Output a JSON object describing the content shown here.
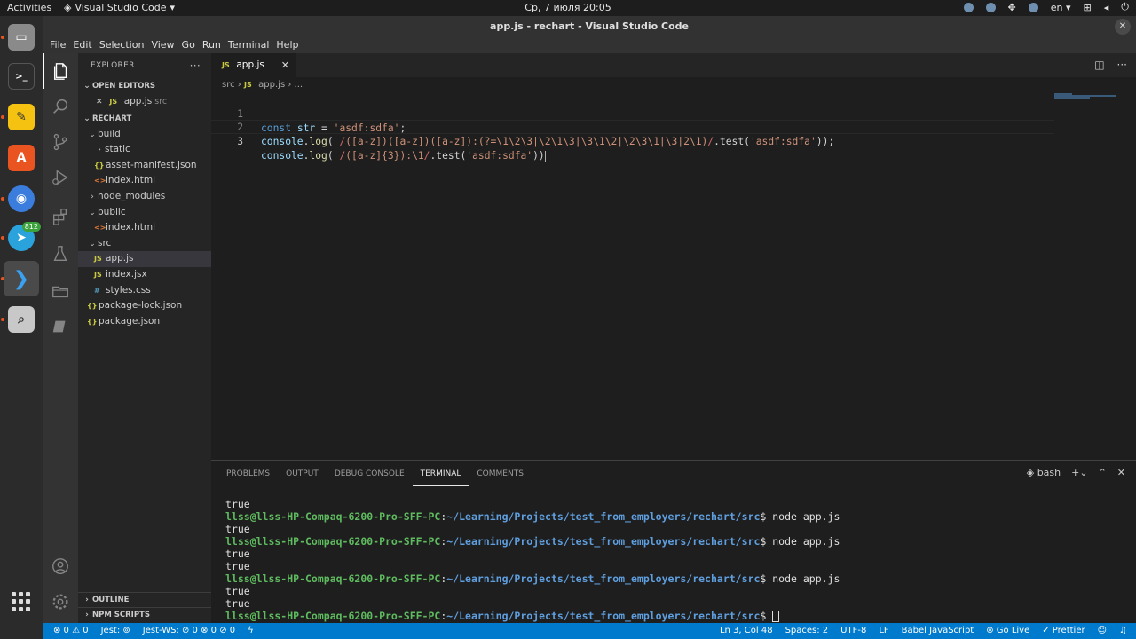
{
  "topbar": {
    "activities": "Activities",
    "app_name": "Visual Studio Code",
    "app_arrow": "▾",
    "clock": "Ср, 7 июля  20:05",
    "lang": "en",
    "lang_arrow": "▾"
  },
  "dock": {
    "telegram_badge": "812"
  },
  "window": {
    "title": "app.js - rechart - Visual Studio Code",
    "close": "✕"
  },
  "menu": [
    "File",
    "Edit",
    "Selection",
    "View",
    "Go",
    "Run",
    "Terminal",
    "Help"
  ],
  "explorer": {
    "title": "EXPLORER",
    "more": "···",
    "open_editors": "OPEN EDITORS",
    "open_file": "app.js",
    "open_file_dir": "src",
    "project": "RECHART",
    "tree": {
      "build": "build",
      "static": "static",
      "asset_manifest": "asset-manifest.json",
      "build_index": "index.html",
      "node_modules": "node_modules",
      "public": "public",
      "public_index": "index.html",
      "src": "src",
      "app_js": "app.js",
      "index_jsx": "index.jsx",
      "styles_css": "styles.css",
      "package_lock": "package-lock.json",
      "package_json": "package.json"
    },
    "outline": "OUTLINE",
    "npm_scripts": "NPM SCRIPTS"
  },
  "tabs": {
    "active_tab": "app.js",
    "close": "✕"
  },
  "breadcrumb": {
    "folder": "src",
    "file": "app.js",
    "rest": "..."
  },
  "editor": {
    "line_numbers": [
      "1",
      "2",
      "3"
    ],
    "line1": {
      "kw": "const",
      "var": "str",
      "op": " = ",
      "str": "'asdf:sdfa'",
      "end": ";"
    },
    "line2": {
      "obj": "console",
      "dot": ".",
      "fn": "log",
      "open": "( ",
      "rx1": "/",
      "rx2": "([a-z])([a-z])([a-z]):(?=\\1\\2\\3|\\2\\1\\3|\\3\\1\\2|\\2\\3\\1|\\3|2\\1)",
      "rx3": "/",
      "rest": ".test(",
      "str": "'asdf:sdfa'",
      "end": "));"
    },
    "line3": {
      "obj": "console",
      "dot": ".",
      "fn": "log",
      "open": "( ",
      "rx1": "/",
      "rx2": "([a-z]{3}):\\1",
      "rx3": "/",
      "rest": ".test(",
      "str": "'asdf:sdfa'",
      "end": "))"
    }
  },
  "panel": {
    "tabs": [
      "PROBLEMS",
      "OUTPUT",
      "DEBUG CONSOLE",
      "TERMINAL",
      "COMMENTS"
    ],
    "shell": "bash",
    "terminal": {
      "out": "true",
      "user": "llss@llss-HP-Compaq-6200-Pro-SFF-PC",
      "sep": ":",
      "path": "~/Learning/Projects/test_from_employers/rechart/src",
      "prompt": "$",
      "cmd": " node app.js"
    }
  },
  "status": {
    "errors": "⊗ 0 ⚠ 0",
    "jest": "Jest: ⊚",
    "jest_ws": "Jest-WS: ⊘ 0 ⊗ 0 ⊘ 0",
    "bolt": "ϟ",
    "position": "Ln 3, Col 48",
    "spaces": "Spaces: 2",
    "encoding": "UTF-8",
    "eol": "LF",
    "language": "Babel JavaScript",
    "golive": "⊚ Go Live",
    "prettier": "✓ Prettier"
  },
  "colors": {
    "accent": "#007acc",
    "sidebar": "#252526",
    "editor": "#1e1e1e"
  }
}
